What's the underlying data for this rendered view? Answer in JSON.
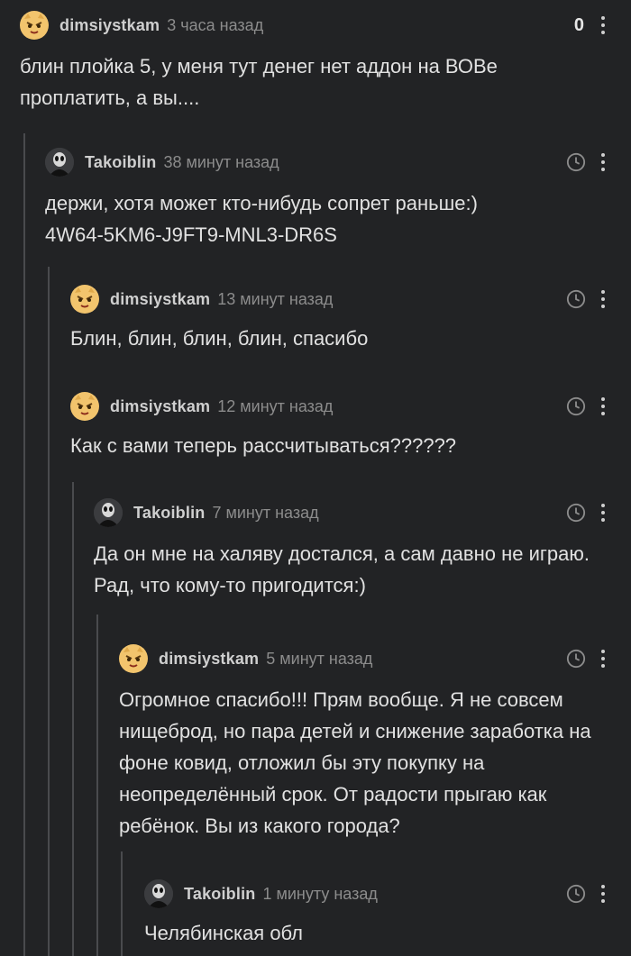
{
  "comments": [
    {
      "author": "dimsiystkam",
      "time": "3 часа назад",
      "rating": "0",
      "avatar_icon": "cat-face-icon",
      "text": "блин плойка 5, у меня тут денег нет аддон на ВОВе проплатить, а вы...."
    },
    {
      "author": "Takoiblin",
      "time": "38 минут назад",
      "avatar_icon": "dark-figure-icon",
      "text": "держи, хотя может кто-нибудь сопрет раньше:)\n4W64-5KM6-J9FT9-MNL3-DR6S"
    },
    {
      "author": "dimsiystkam",
      "time": "13 минут назад",
      "avatar_icon": "cat-face-icon",
      "text": "Блин, блин, блин, блин, спасибо"
    },
    {
      "author": "dimsiystkam",
      "time": "12 минут назад",
      "avatar_icon": "cat-face-icon",
      "text": "Как с вами теперь рассчитываться??????"
    },
    {
      "author": "Takoiblin",
      "time": "7 минут назад",
      "avatar_icon": "dark-figure-icon",
      "text": "Да он мне на халяву достался, а сам давно не играю. Рад, что кому-то пригодится:)"
    },
    {
      "author": "dimsiystkam",
      "time": "5 минут назад",
      "avatar_icon": "cat-face-icon",
      "text": "Огромное спасибо!!! Прям вообще. Я не совсем нищеброд, но пара детей и снижение заработка на фоне ковид, отложил бы эту покупку на неопределённый срок. От радости прыгаю как ребёнок. Вы из какого города?"
    },
    {
      "author": "Takoiblin",
      "time": "1 минуту назад",
      "avatar_icon": "dark-figure-icon",
      "text": "Челябинская обл"
    }
  ],
  "colors": {
    "background": "#222325",
    "thread_line": "#4a4b4e",
    "author": "#cfcfcf",
    "time": "#8c8c8c",
    "text": "#e1e1e1"
  }
}
